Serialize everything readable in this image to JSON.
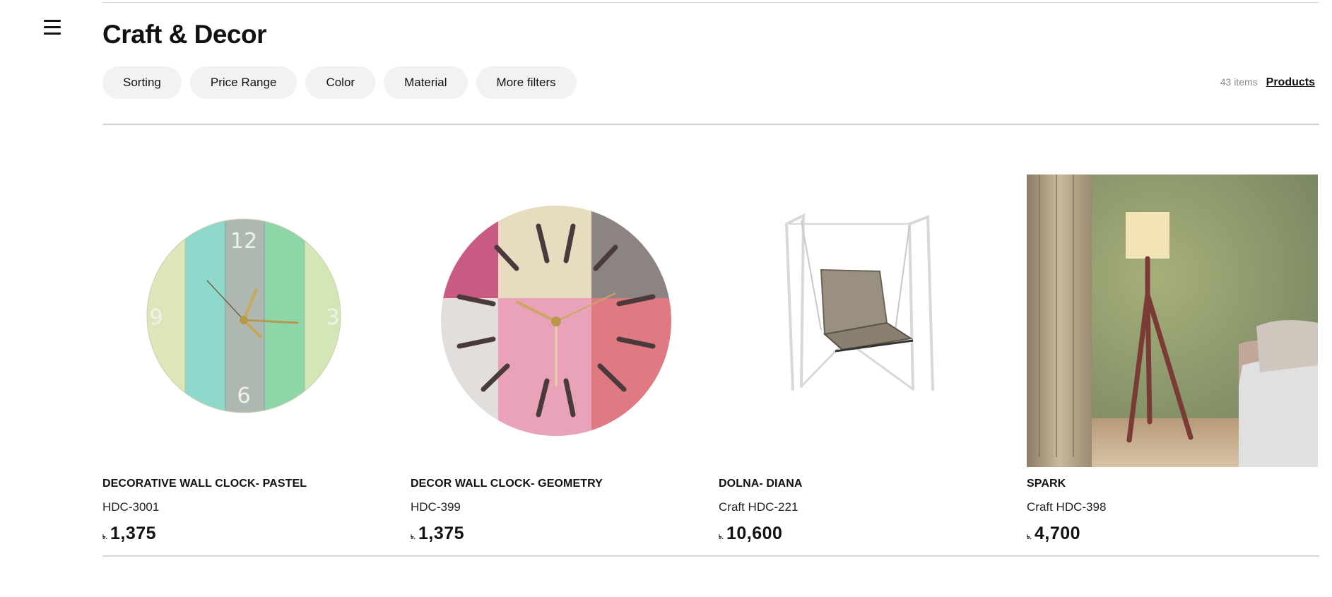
{
  "header": {
    "title": "Craft & Decor",
    "menu_icon": "hamburger-menu-icon"
  },
  "filters": [
    {
      "label": "Sorting"
    },
    {
      "label": "Price Range"
    },
    {
      "label": "Color"
    },
    {
      "label": "Material"
    },
    {
      "label": "More filters"
    }
  ],
  "meta": {
    "item_count": "43 items",
    "products_link": "Products"
  },
  "products": [
    {
      "name": "DECORATIVE WALL CLOCK- PASTEL",
      "code": "HDC-3001",
      "currency": "৳.",
      "price": "1,375",
      "image": "pastel-wall-clock"
    },
    {
      "name": "DECOR WALL CLOCK- GEOMETRY",
      "code": "HDC-399",
      "currency": "৳.",
      "price": "1,375",
      "image": "geometry-wall-clock"
    },
    {
      "name": "DOLNA- DIANA",
      "code": "Craft HDC-221",
      "currency": "৳.",
      "price": "10,600",
      "image": "swing-chair"
    },
    {
      "name": "SPARK",
      "code": "Craft HDC-398",
      "currency": "৳.",
      "price": "4,700",
      "image": "floor-lamp-room"
    }
  ]
}
